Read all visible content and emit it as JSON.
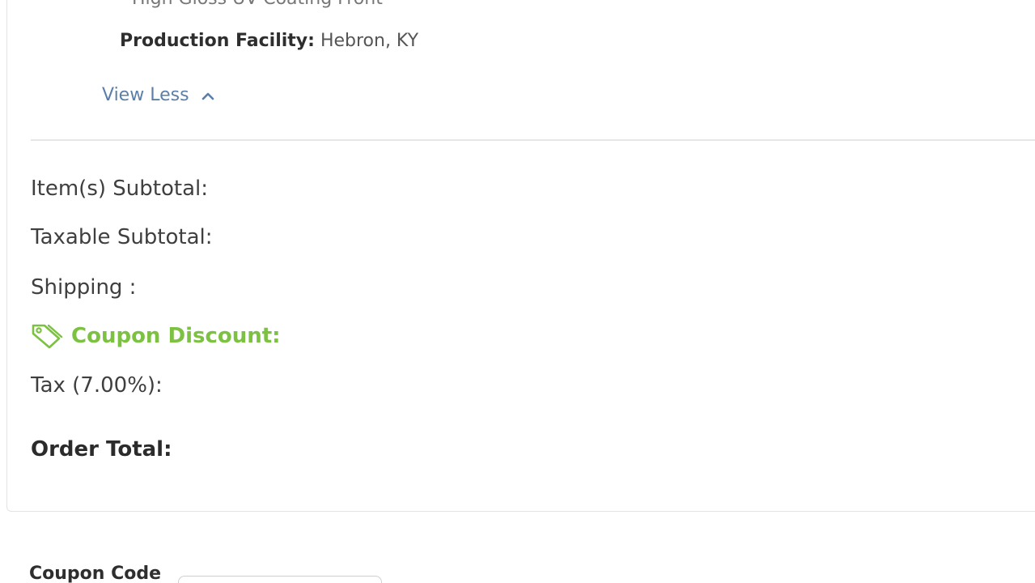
{
  "product_details": {
    "coating_line": "High Gloss UV Coating Front",
    "facility_label": "Production Facility:",
    "facility_value": "Hebron, KY",
    "view_less_label": "View Less"
  },
  "summary": {
    "items_subtotal_label": "Item(s) Subtotal:",
    "taxable_subtotal_label": "Taxable Subtotal:",
    "shipping_label": "Shipping :",
    "coupon_discount_label": "Coupon Discount:",
    "tax_label": "Tax (7.00%):",
    "order_total_label": "Order Total:"
  },
  "coupon": {
    "label": "Coupon Code",
    "value": ""
  },
  "colors": {
    "accent_link": "#5b7fa8",
    "discount_green": "#7cc142"
  },
  "icons": {
    "view_less": "chevron-up-icon",
    "coupon": "tag-icon"
  }
}
